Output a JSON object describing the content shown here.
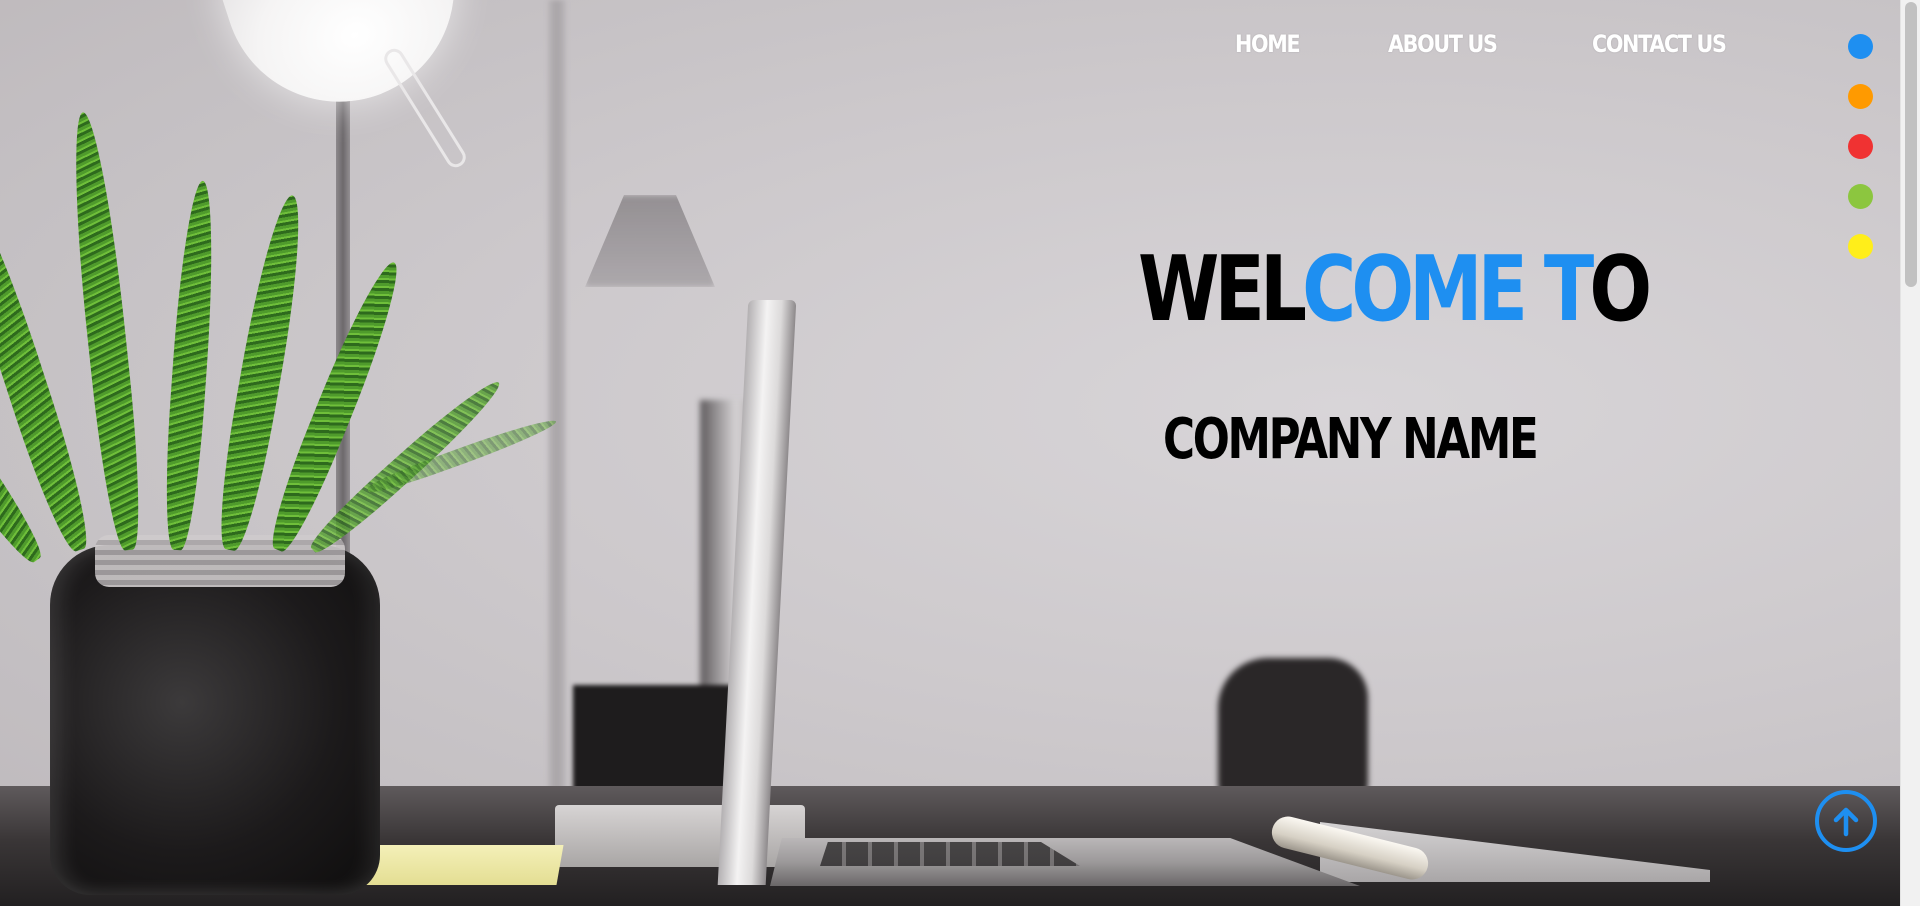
{
  "nav": {
    "items": [
      {
        "label": "HOME"
      },
      {
        "label": "ABOUT US"
      },
      {
        "label": "CONTACT US"
      }
    ]
  },
  "color_switcher": {
    "swatches": [
      {
        "name": "blue",
        "color": "#1e8ff1"
      },
      {
        "name": "orange",
        "color": "#ff9a00"
      },
      {
        "name": "red",
        "color": "#f03232"
      },
      {
        "name": "green",
        "color": "#8cc63f"
      },
      {
        "name": "yellow",
        "color": "#ffee1a"
      }
    ]
  },
  "hero": {
    "title_parts": [
      "WEL",
      "COME T",
      "O"
    ],
    "subtitle": "COMPANY NAME",
    "accent_color": "#1e8ff1"
  },
  "scroll_top": {
    "icon": "arrow-up-icon"
  }
}
